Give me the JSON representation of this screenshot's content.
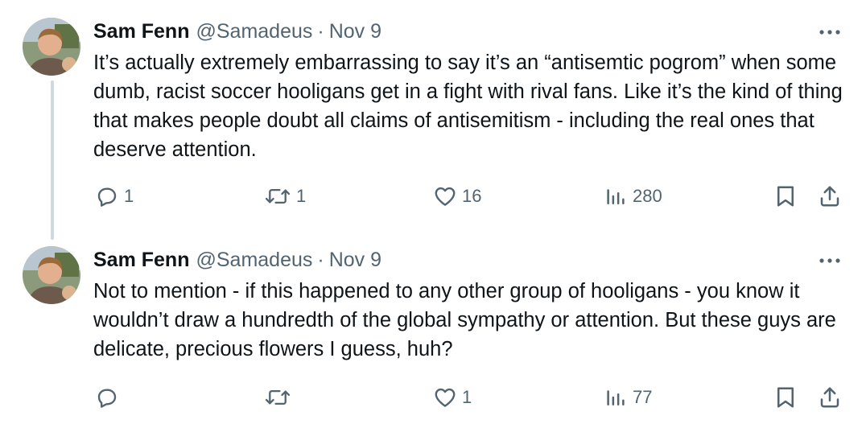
{
  "tweets": [
    {
      "name": "Sam Fenn",
      "handle": "@Samadeus",
      "separator": "·",
      "date": "Nov 9",
      "text": "It’s actually extremely embarrassing to say it’s an “antisemtic pogrom” when some dumb, racist soccer hooligans get in a fight with rival fans. Like it’s the kind of thing that makes people doubt all claims of antisemitism - including the real ones that deserve attention.",
      "reply_count": "1",
      "retweet_count": "1",
      "like_count": "16",
      "view_count": "280"
    },
    {
      "name": "Sam Fenn",
      "handle": "@Samadeus",
      "separator": "·",
      "date": "Nov 9",
      "text": "Not to mention - if this happened to any other group of hooligans - you know it wouldn’t draw a hundredth of the global sympathy or attention. But these guys are delicate, precious flowers I guess, huh?",
      "reply_count": "",
      "retweet_count": "",
      "like_count": "1",
      "view_count": "77"
    }
  ],
  "icons": {
    "more": "more-horizontal-icon",
    "reply": "reply-bubble-icon",
    "retweet": "retweet-icon",
    "like": "heart-icon",
    "views": "bar-chart-icon",
    "bookmark": "bookmark-icon",
    "share": "share-upload-icon"
  },
  "colors": {
    "text": "#0f1419",
    "secondary": "#536471",
    "thread_line": "#cfd9de"
  }
}
